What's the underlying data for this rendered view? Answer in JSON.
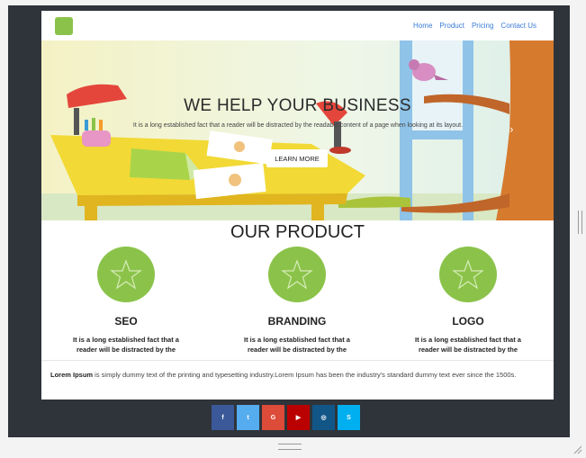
{
  "nav": {
    "items": [
      "Home",
      "Product",
      "Pricing",
      "Contact Us"
    ]
  },
  "hero": {
    "title": "WE HELP YOUR BUSINESS",
    "text": "It is a long established fact that a reader will be distracted by the readable content of a page when looking at its layout.",
    "button": "LEARN MORE",
    "next_icon": "chevron-right-icon"
  },
  "products": {
    "title": "OUR PRODUCT",
    "items": [
      {
        "name": "SEO",
        "desc": "It is a long established fact that a reader will be distracted by the readable content",
        "icon": "star-icon"
      },
      {
        "name": "BRANDING",
        "desc": "It is a long established fact that a reader will be distracted by the readable content",
        "icon": "star-icon"
      },
      {
        "name": "LOGO",
        "desc": "It is a long established fact that a reader will be distracted by the readable content",
        "icon": "star-icon"
      }
    ]
  },
  "lorem": {
    "bold": "Lorem Ipsum",
    "text": " is simply dummy text of the printing and typesetting industry.Lorem Ipsum has been the industry's standard dummy text ever since the 1500s."
  },
  "social": [
    {
      "label": "f",
      "color": "#3b5998",
      "icon": "facebook-icon"
    },
    {
      "label": "t",
      "color": "#55acee",
      "icon": "twitter-icon"
    },
    {
      "label": "G",
      "color": "#dd4b39",
      "icon": "google-plus-icon"
    },
    {
      "label": "▶",
      "color": "#bb0000",
      "icon": "youtube-icon"
    },
    {
      "label": "◎",
      "color": "#125688",
      "icon": "instagram-icon"
    },
    {
      "label": "S",
      "color": "#00aff0",
      "icon": "skype-icon"
    }
  ],
  "colors": {
    "accent": "#8bc34a",
    "link": "#3a7bd5",
    "frame": "#2f343a"
  }
}
